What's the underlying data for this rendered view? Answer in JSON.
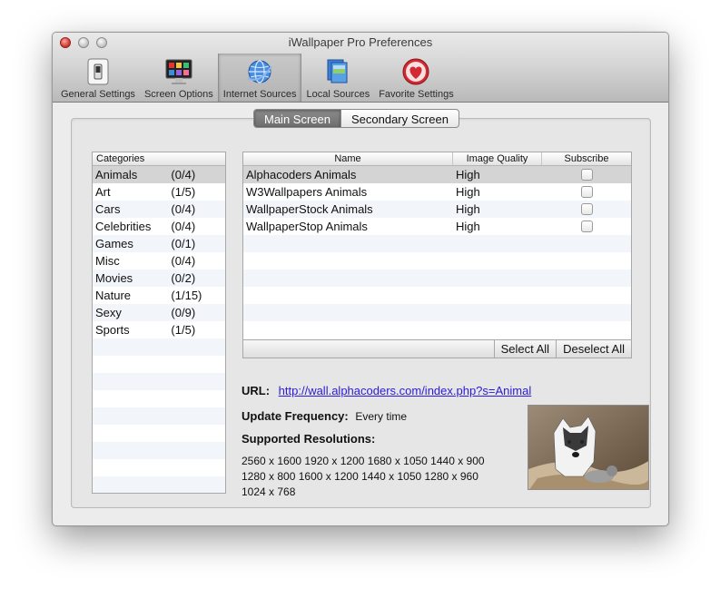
{
  "window": {
    "title": "iWallpaper Pro Preferences"
  },
  "toolbar": {
    "items": [
      {
        "label": "General Settings",
        "icon": "switch-icon"
      },
      {
        "label": "Screen Options",
        "icon": "monitor-icon"
      },
      {
        "label": "Internet Sources",
        "icon": "globe-icon",
        "selected": true
      },
      {
        "label": "Local Sources",
        "icon": "folder-icon"
      },
      {
        "label": "Favorite Settings",
        "icon": "heart-icon"
      }
    ]
  },
  "segments": {
    "main": "Main Screen",
    "secondary": "Secondary Screen",
    "active": "main"
  },
  "categories": {
    "header": "Categories",
    "items": [
      {
        "name": "Animals",
        "count": "(0/4)",
        "selected": true
      },
      {
        "name": "Art",
        "count": "(1/5)"
      },
      {
        "name": "Cars",
        "count": "(0/4)"
      },
      {
        "name": "Celebrities",
        "count": "(0/4)"
      },
      {
        "name": "Games",
        "count": "(0/1)"
      },
      {
        "name": "Misc",
        "count": "(0/4)"
      },
      {
        "name": "Movies",
        "count": "(0/2)"
      },
      {
        "name": "Nature",
        "count": "(1/15)"
      },
      {
        "name": "Sexy",
        "count": "(0/9)"
      },
      {
        "name": "Sports",
        "count": "(1/5)"
      }
    ]
  },
  "sources": {
    "columns": {
      "name": "Name",
      "quality": "Image Quality",
      "subscribe": "Subscribe"
    },
    "rows": [
      {
        "name": "Alphacoders Animals",
        "quality": "High",
        "subscribed": false,
        "selected": true
      },
      {
        "name": "W3Wallpapers Animals",
        "quality": "High",
        "subscribed": false
      },
      {
        "name": "WallpaperStock Animals",
        "quality": "High",
        "subscribed": false
      },
      {
        "name": "WallpaperStop Animals",
        "quality": "High",
        "subscribed": false
      }
    ],
    "select_all": "Select All",
    "deselect_all": "Deselect All"
  },
  "details": {
    "url_label": "URL:",
    "url": "http://wall.alphacoders.com/index.php?s=Animal",
    "frequency_label": "Update Frequency:",
    "frequency_value": "Every time",
    "resolutions_label": "Supported Resolutions:",
    "resolutions_text": "2560 x 1600  1920 x 1200  1680 x 1050  1440 x 900  1280 x 800  1600 x 1200  1440 x 1050  1280 x 960  1024 x 768"
  }
}
